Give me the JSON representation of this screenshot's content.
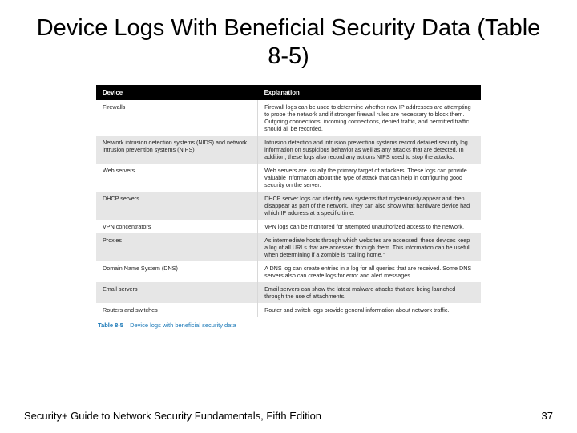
{
  "slide": {
    "title": "Device Logs With Beneficial Security Data (Table 8-5)"
  },
  "table": {
    "headers": {
      "h1": "Device",
      "h2": "Explanation"
    },
    "rows": [
      {
        "device": "Firewalls",
        "explanation": "Firewall logs can be used to determine whether new IP addresses are attempting to probe the network and if stronger firewall rules are necessary to block them. Outgoing connections, incoming connections, denied traffic, and permitted traffic should all be recorded."
      },
      {
        "device": "Network intrusion detection systems (NIDS) and network intrusion prevention systems (NIPS)",
        "explanation": "Intrusion detection and intrusion prevention systems record detailed security log information on suspicious behavior as well as any attacks that are detected. In addition, these logs also record any actions NIPS used to stop the attacks."
      },
      {
        "device": "Web servers",
        "explanation": "Web servers are usually the primary target of attackers. These logs can provide valuable information about the type of attack that can help in configuring good security on the server."
      },
      {
        "device": "DHCP servers",
        "explanation": "DHCP server logs can identify new systems that mysteriously appear and then disappear as part of the network. They can also show what hardware device had which IP address at a specific time."
      },
      {
        "device": "VPN concentrators",
        "explanation": "VPN logs can be monitored for attempted unauthorized access to the network."
      },
      {
        "device": "Proxies",
        "explanation": "As intermediate hosts through which websites are accessed, these devices keep a log of all URLs that are accessed through them. This information can be useful when determining if a zombie is \"calling home.\""
      },
      {
        "device": "Domain Name System (DNS)",
        "explanation": "A DNS log can create entries in a log for all queries that are received. Some DNS servers also can create logs for error and alert messages."
      },
      {
        "device": "Email servers",
        "explanation": "Email servers can show the latest malware attacks that are being launched through the use of attachments."
      },
      {
        "device": "Routers and switches",
        "explanation": "Router and switch logs provide general information about network traffic."
      }
    ],
    "caption": {
      "label": "Table 8-5",
      "text": "Device logs with beneficial security data"
    }
  },
  "footer": {
    "left": "Security+ Guide to Network Security Fundamentals, Fifth Edition",
    "right": "37"
  }
}
